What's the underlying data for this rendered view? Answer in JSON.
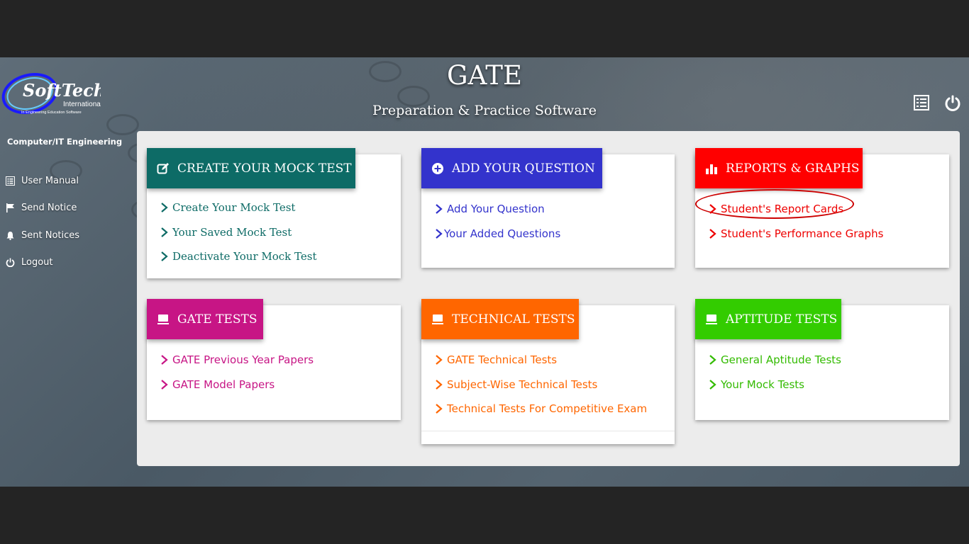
{
  "header": {
    "title": "GATE",
    "subtitle": "Preparation & Practice Software"
  },
  "logo": {
    "name": "SoftTech",
    "tagline": "International",
    "sub": "In Engineering Education Software"
  },
  "sidebar": {
    "department": "Computer/IT Engineering",
    "items": [
      {
        "label": "User Manual",
        "icon": "list-icon"
      },
      {
        "label": "Send Notice",
        "icon": "flag-icon"
      },
      {
        "label": "Sent Notices",
        "icon": "bell-icon"
      },
      {
        "label": "Logout",
        "icon": "power-icon"
      }
    ]
  },
  "top_icons": [
    "report-list-icon",
    "power-icon"
  ],
  "cards": [
    {
      "title": "CREATE YOUR MOCK TEST",
      "color": "#0d6b66",
      "icon": "edit-icon",
      "links": [
        "Create Your Mock Test",
        "Your Saved Mock Test",
        "Deactivate Your Mock Test"
      ]
    },
    {
      "title": "ADD YOUR QUESTION",
      "color": "#3333cc",
      "icon": "plus-circle-icon",
      "links": [
        "Add Your Question",
        "Your Added Questions"
      ]
    },
    {
      "title": "REPORTS & GRAPHS",
      "color": "#ff0000",
      "icon": "bar-chart-icon",
      "links": [
        "Student's Report Cards",
        "Student's Performance Graphs"
      ]
    },
    {
      "title": "GATE TESTS",
      "color": "#c71585",
      "icon": "monitor-icon",
      "links": [
        "GATE Previous Year Papers",
        "GATE Model Papers"
      ]
    },
    {
      "title": "TECHNICAL TESTS",
      "color": "#ff6600",
      "icon": "monitor-icon",
      "links": [
        "GATE Technical Tests",
        "Subject-Wise Technical Tests",
        "Technical Tests For Competitive Exam"
      ]
    },
    {
      "title": "APTITUDE TESTS",
      "color": "#33cc00",
      "icon": "monitor-icon",
      "links": [
        "General Aptitude Tests",
        "Your Mock Tests"
      ]
    }
  ]
}
